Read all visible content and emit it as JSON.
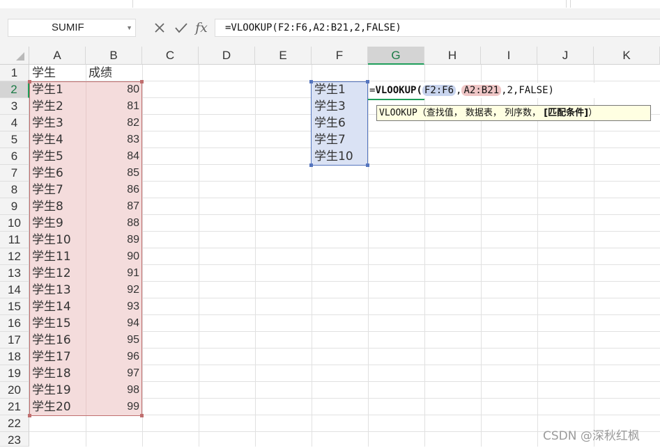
{
  "formula_bar": {
    "name_box": "SUMIF",
    "cancel_icon": "close-icon",
    "confirm_icon": "check-icon",
    "fx_label": "fx",
    "formula": "=VLOOKUP(F2:F6,A2:B21,2,FALSE)"
  },
  "columns": [
    "A",
    "B",
    "C",
    "D",
    "E",
    "F",
    "G",
    "H",
    "I",
    "J",
    "K"
  ],
  "selected_column": "G",
  "rows": [
    "1",
    "2",
    "3",
    "4",
    "5",
    "6",
    "7",
    "8",
    "9",
    "10",
    "11",
    "12",
    "13",
    "14",
    "15",
    "16",
    "17",
    "18",
    "19",
    "20",
    "21",
    "22",
    "23"
  ],
  "selected_row": "2",
  "sheet": {
    "header_a1": "学生",
    "header_b1": "成绩",
    "students": [
      "学生1",
      "学生2",
      "学生3",
      "学生4",
      "学生5",
      "学生6",
      "学生7",
      "学生8",
      "学生9",
      "学生10",
      "学生11",
      "学生12",
      "学生13",
      "学生14",
      "学生15",
      "学生16",
      "学生17",
      "学生18",
      "学生19",
      "学生20"
    ],
    "scores": [
      "80",
      "81",
      "82",
      "83",
      "84",
      "85",
      "86",
      "87",
      "88",
      "89",
      "90",
      "91",
      "92",
      "93",
      "94",
      "95",
      "96",
      "97",
      "98",
      "99"
    ],
    "lookup_values": [
      "学生1",
      "学生3",
      "学生6",
      "学生7",
      "学生10"
    ]
  },
  "cell_edit": {
    "prefix": "=",
    "function": "VLOOKUP",
    "open_paren": "(",
    "ref1": "F2:F6",
    "comma1": ",",
    "ref2": "A2:B21",
    "rest": ",2,FALSE)"
  },
  "tooltip": {
    "function": "VLOOKUP",
    "args": "（查找值， 数据表， 列序数， ",
    "current_arg": "[匹配条件]",
    "close": "）"
  },
  "watermark": "CSDN @深秋红枫",
  "colors": {
    "range_ab_fill": "#f4dcdc",
    "range_ab_border": "#bf6e6e",
    "range_f_fill": "#dae2f4",
    "range_f_border": "#5575be",
    "selection_accent": "#1e9e5a",
    "tooltip_bg": "#ffffe2"
  }
}
